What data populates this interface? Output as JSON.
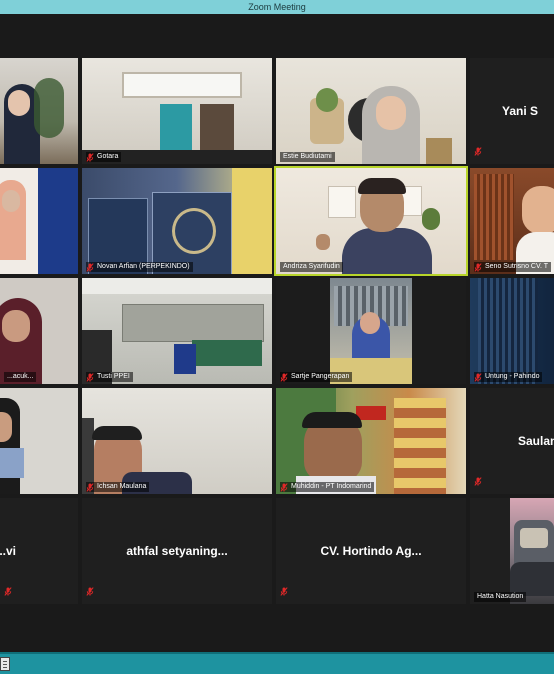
{
  "window": {
    "title": "Zoom Meeting"
  },
  "participants": [
    {
      "name": "",
      "video": true
    },
    {
      "name": "Gotara",
      "video": true
    },
    {
      "name": "Estie Budiutami",
      "video": true
    },
    {
      "name": "Yani S",
      "video": false
    },
    {
      "name": "",
      "video": true
    },
    {
      "name": "Novan Arfian (PERPEKINDO)",
      "video": true
    },
    {
      "name": "Andriza Syarifudin",
      "video": true,
      "active_speaker": true
    },
    {
      "name": "Seno Sutrisno CV. T",
      "video": true
    },
    {
      "name": "...acuk...",
      "video": true
    },
    {
      "name": "Tusti PPEI",
      "video": true
    },
    {
      "name": "Sartje Pangerapan",
      "video": true
    },
    {
      "name": "Untung - Pahindo",
      "video": true
    },
    {
      "name": "",
      "video": true
    },
    {
      "name": "Ichsan Maulana",
      "video": true
    },
    {
      "name": "Muhiddin - PT Indomarind",
      "video": true
    },
    {
      "name": "Saulan",
      "video": false
    },
    {
      "name": "...vi",
      "video": false
    },
    {
      "name": "athfal setyaning...",
      "video": false
    },
    {
      "name": "CV. Hortindo Ag...",
      "video": false
    },
    {
      "name": "Hatta Nasution",
      "video": true
    }
  ],
  "icons": {
    "muted": "mic-muted-icon",
    "taskbar": "window-list-icon"
  },
  "colors": {
    "titlebar": "#7fd0d8",
    "active_border": "#b8d52a",
    "muted_red": "#e02828",
    "taskbar": "#1e93a0"
  }
}
